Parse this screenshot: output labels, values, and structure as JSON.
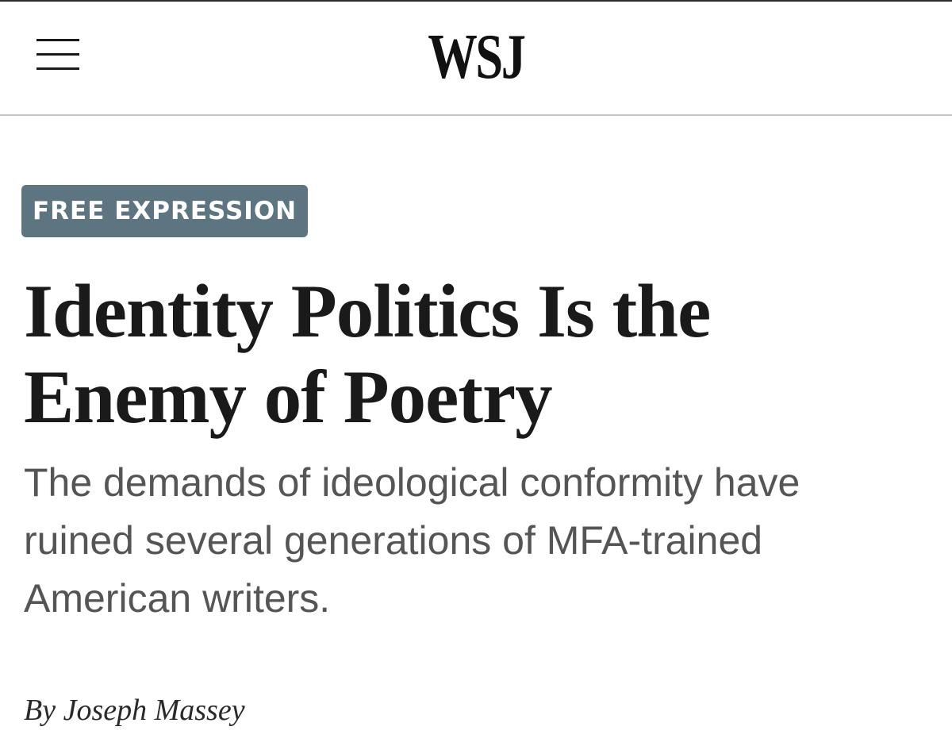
{
  "header": {
    "logo": "WSJ",
    "menu_icon": "hamburger-menu-icon"
  },
  "article": {
    "section_label": "FREE EXPRESSION",
    "headline_lines": [
      "Identity Politics Is the",
      "Enemy of Poetry"
    ],
    "dek_lines": [
      "The demands of ideological conformity have",
      "ruined several generations of MFA-trained",
      "American writers."
    ],
    "byline_prefix": "By",
    "author": "Joseph Massey"
  },
  "colors": {
    "badge_background": "#5d7581",
    "headline_text": "#1a1a1a",
    "dek_text": "#555555"
  }
}
